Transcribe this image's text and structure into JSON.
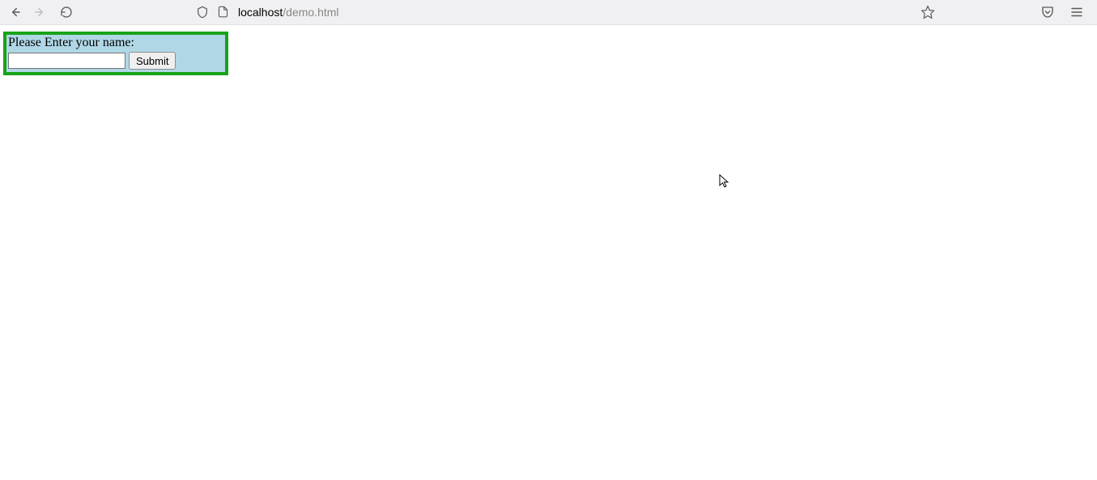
{
  "browser": {
    "url_host": "localhost",
    "url_path": "/demo.html"
  },
  "form": {
    "label": "Please Enter your name:",
    "input_value": "",
    "submit_label": "Submit"
  }
}
